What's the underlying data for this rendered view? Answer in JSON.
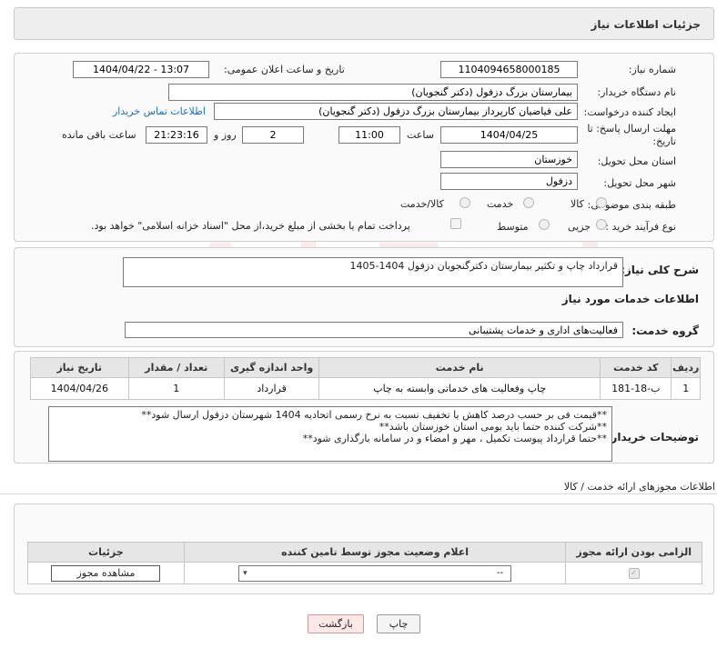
{
  "header": {
    "title": "جزئیات اطلاعات نیاز"
  },
  "form": {
    "need_number_label": "شماره نیاز:",
    "need_number": "1104094658000185",
    "announce_label": "تاریخ و ساعت اعلان عمومی:",
    "announce_value": "1404/04/22 - 13:07",
    "buyer_org_label": "نام دستگاه خریدار:",
    "buyer_org": "بیمارستان بزرگ دزفول (دکتر گنجویان)",
    "requester_label": "ایجاد کننده درخواست:",
    "requester": "علی فیاضیان کارپرداز بیمارستان بزرگ دزفول (دکتر گنجویان)",
    "contact_link": "اطلاعات تماس خریدار",
    "deadline_label_1": "مهلت ارسال پاسخ: تا",
    "deadline_label_2": "تاریخ:",
    "deadline_date": "1404/04/25",
    "time_label": "ساعت",
    "deadline_time": "11:00",
    "days_value": "2",
    "days_label": "روز و",
    "remaining_time": "21:23:16",
    "remaining_label": "ساعت باقی مانده",
    "province_label": "استان محل تحویل:",
    "province": "خوزستان",
    "city_label": "شهر محل تحویل:",
    "city": "دزفول",
    "category_label": "طبقه بندی موضوعی:",
    "category_options": [
      "کالا",
      "خدمت",
      "کالا/خدمت"
    ],
    "process_label": "نوع فرآیند خرید :",
    "process_options": [
      "جزیی",
      "متوسط"
    ],
    "treasury_note": "پرداخت تمام یا بخشی از مبلغ خرید،از محل \"اسناد خزانه اسلامی\" خواهد بود."
  },
  "summary": {
    "label": "شرح کلی نیاز:",
    "text": "قرارداد چاپ و تکثیر بیمارستان دکترگنجویان دزفول 1404-1405"
  },
  "services": {
    "section_title": "اطلاعات خدمات مورد نیاز",
    "group_label": "گروه خدمت:",
    "group_value": "فعالیت‌های اداری و خدمات پشتیبانی",
    "columns": [
      "ردیف",
      "کد خدمت",
      "نام خدمت",
      "واحد اندازه گیری",
      "تعداد / مقدار",
      "تاریخ نیاز"
    ],
    "rows": [
      {
        "index": "1",
        "code": "ب-18-181",
        "name": "چاپ وفعالیت های خدماتی وابسته به چاپ",
        "unit": "قرارداد",
        "qty": "1",
        "date": "1404/04/26"
      }
    ]
  },
  "buyer_notes": {
    "label": "توضیحات خریدار:",
    "lines": [
      "**قیمت فی بر حسب درصد کاهش یا تخفیف نسبت به نرخ رسمی اتحادیه 1404 شهرستان دزفول ارسال شود**",
      "**شرکت کننده حتما باید بومی استان خوزستان باشد**",
      "**حتما قرارداد پیوست تکمیل ، مهر و امضاء و در سامانه بارگذاری شود**"
    ]
  },
  "permits": {
    "section_title": "اطلاعات مجوزهای ارائه خدمت / کالا",
    "columns": [
      "الزامی بودن ارائه مجوز",
      "اعلام وضعیت مجوز توسط تامین کننده",
      "جزئیات"
    ],
    "select_value": "--",
    "view_button": "مشاهده مجوز"
  },
  "footer": {
    "print_button": "چاپ",
    "back_button": "بازگشت"
  },
  "watermark": {
    "text": "AriaTender.neT"
  }
}
